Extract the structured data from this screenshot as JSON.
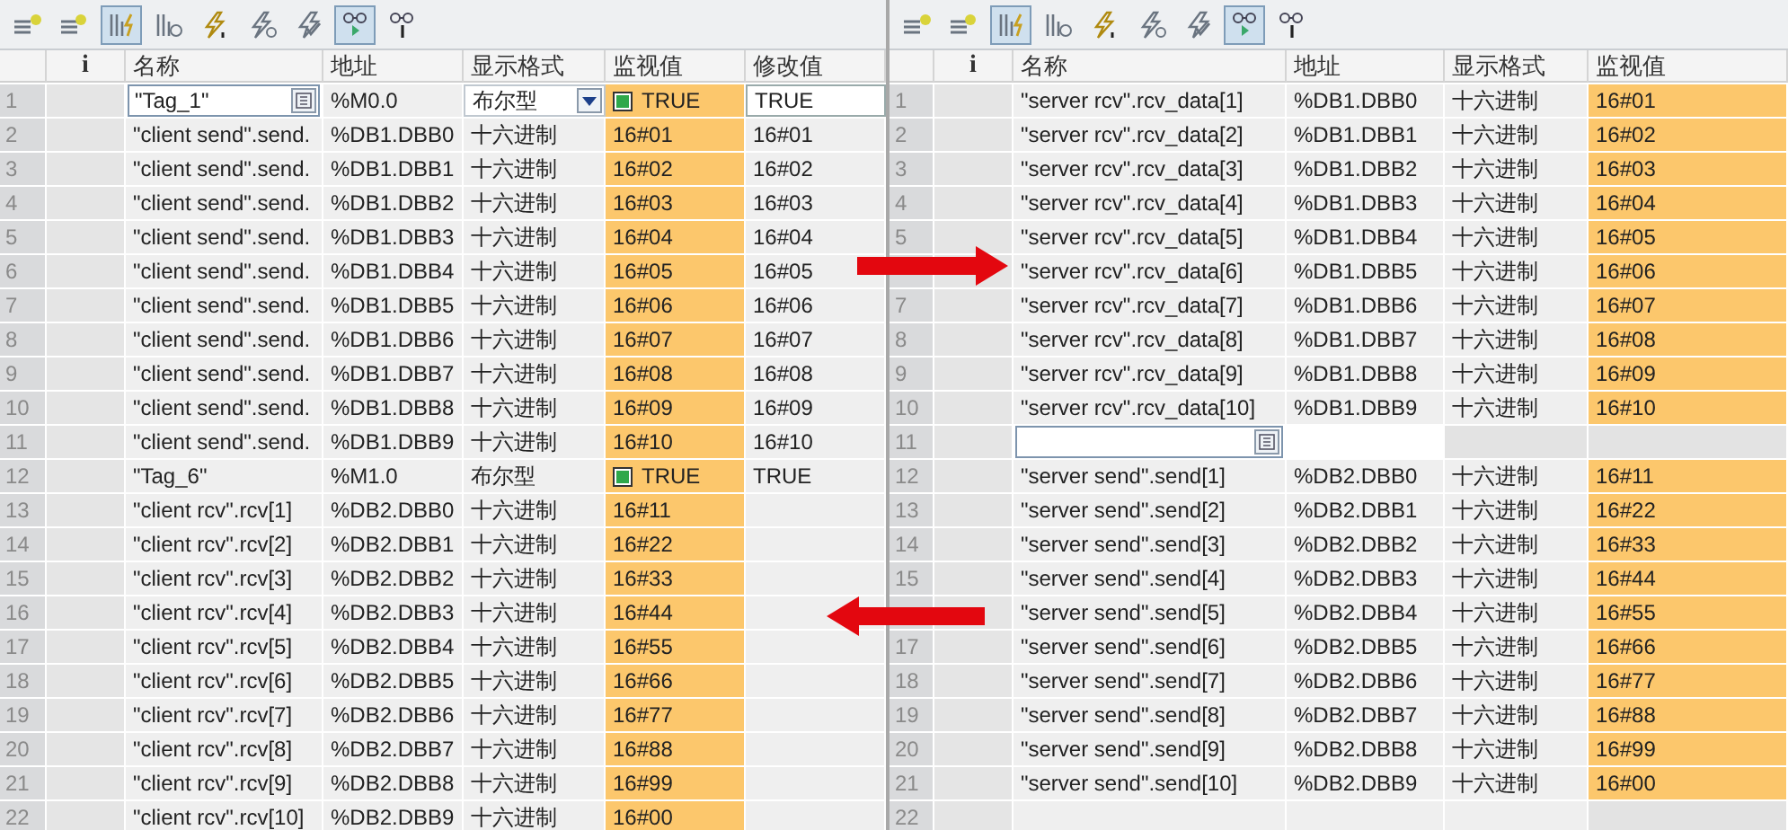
{
  "panels": [
    {
      "toolbar": [
        {
          "kind": "insert-row",
          "pressed": false
        },
        {
          "kind": "add-row",
          "pressed": false
        },
        {
          "kind": "modify-now",
          "pressed": true
        },
        {
          "kind": "modify-time",
          "pressed": false
        },
        {
          "kind": "force",
          "pressed": false
        },
        {
          "kind": "force-time",
          "pressed": false
        },
        {
          "kind": "check",
          "pressed": false
        },
        {
          "kind": "monitor-all",
          "pressed": true
        },
        {
          "kind": "monitor-once",
          "pressed": false
        }
      ],
      "columns": [
        "i",
        "名称",
        "地址",
        "显示格式",
        "监视值",
        "修改值"
      ],
      "rows": [
        {
          "num": "1",
          "name": "\"Tag_1\"",
          "address": "%M0.0",
          "format": "布尔型",
          "monitor": "TRUE",
          "led": true,
          "modify": "TRUE",
          "editing": true
        },
        {
          "num": "2",
          "name": "\"client send\".send.",
          "address": "%DB1.DBB0",
          "format": "十六进制",
          "monitor": "16#01",
          "modify": "16#01",
          "editing": false
        },
        {
          "num": "3",
          "name": "\"client send\".send.",
          "address": "%DB1.DBB1",
          "format": "十六进制",
          "monitor": "16#02",
          "modify": "16#02",
          "editing": false
        },
        {
          "num": "4",
          "name": "\"client send\".send.",
          "address": "%DB1.DBB2",
          "format": "十六进制",
          "monitor": "16#03",
          "modify": "16#03",
          "editing": false
        },
        {
          "num": "5",
          "name": "\"client send\".send.",
          "address": "%DB1.DBB3",
          "format": "十六进制",
          "monitor": "16#04",
          "modify": "16#04",
          "editing": false
        },
        {
          "num": "6",
          "name": "\"client send\".send.",
          "address": "%DB1.DBB4",
          "format": "十六进制",
          "monitor": "16#05",
          "modify": "16#05",
          "editing": false
        },
        {
          "num": "7",
          "name": "\"client send\".send.",
          "address": "%DB1.DBB5",
          "format": "十六进制",
          "monitor": "16#06",
          "modify": "16#06",
          "editing": false
        },
        {
          "num": "8",
          "name": "\"client send\".send.",
          "address": "%DB1.DBB6",
          "format": "十六进制",
          "monitor": "16#07",
          "modify": "16#07",
          "editing": false
        },
        {
          "num": "9",
          "name": "\"client send\".send.",
          "address": "%DB1.DBB7",
          "format": "十六进制",
          "monitor": "16#08",
          "modify": "16#08",
          "editing": false
        },
        {
          "num": "10",
          "name": "\"client send\".send.",
          "address": "%DB1.DBB8",
          "format": "十六进制",
          "monitor": "16#09",
          "modify": "16#09",
          "editing": false
        },
        {
          "num": "11",
          "name": "\"client send\".send.",
          "address": "%DB1.DBB9",
          "format": "十六进制",
          "monitor": "16#10",
          "modify": "16#10",
          "editing": false
        },
        {
          "num": "12",
          "name": "\"Tag_6\"",
          "address": "%M1.0",
          "format": "布尔型",
          "monitor": "TRUE",
          "led": true,
          "modify": "TRUE",
          "editing": false
        },
        {
          "num": "13",
          "name": "\"client rcv\".rcv[1]",
          "address": "%DB2.DBB0",
          "format": "十六进制",
          "monitor": "16#11",
          "editing": false
        },
        {
          "num": "14",
          "name": "\"client rcv\".rcv[2]",
          "address": "%DB2.DBB1",
          "format": "十六进制",
          "monitor": "16#22",
          "editing": false
        },
        {
          "num": "15",
          "name": "\"client rcv\".rcv[3]",
          "address": "%DB2.DBB2",
          "format": "十六进制",
          "monitor": "16#33",
          "editing": false
        },
        {
          "num": "16",
          "name": "\"client rcv\".rcv[4]",
          "address": "%DB2.DBB3",
          "format": "十六进制",
          "monitor": "16#44",
          "editing": false
        },
        {
          "num": "17",
          "name": "\"client rcv\".rcv[5]",
          "address": "%DB2.DBB4",
          "format": "十六进制",
          "monitor": "16#55",
          "editing": false
        },
        {
          "num": "18",
          "name": "\"client rcv\".rcv[6]",
          "address": "%DB2.DBB5",
          "format": "十六进制",
          "monitor": "16#66",
          "editing": false
        },
        {
          "num": "19",
          "name": "\"client rcv\".rcv[7]",
          "address": "%DB2.DBB6",
          "format": "十六进制",
          "monitor": "16#77",
          "editing": false
        },
        {
          "num": "20",
          "name": "\"client rcv\".rcv[8]",
          "address": "%DB2.DBB7",
          "format": "十六进制",
          "monitor": "16#88",
          "editing": false
        },
        {
          "num": "21",
          "name": "\"client rcv\".rcv[9]",
          "address": "%DB2.DBB8",
          "format": "十六进制",
          "monitor": "16#99",
          "editing": false
        },
        {
          "num": "22",
          "name": "\"client rcv\".rcv[10]",
          "address": "%DB2.DBB9",
          "format": "十六进制",
          "monitor": "16#00",
          "editing": false
        }
      ]
    },
    {
      "toolbar": [
        {
          "kind": "insert-row",
          "pressed": false
        },
        {
          "kind": "add-row",
          "pressed": false
        },
        {
          "kind": "modify-now",
          "pressed": true
        },
        {
          "kind": "modify-time",
          "pressed": false
        },
        {
          "kind": "force",
          "pressed": false
        },
        {
          "kind": "force-time",
          "pressed": false
        },
        {
          "kind": "check",
          "pressed": false
        },
        {
          "kind": "monitor-all",
          "pressed": true
        },
        {
          "kind": "monitor-once",
          "pressed": false
        }
      ],
      "columns": [
        "i",
        "名称",
        "地址",
        "显示格式",
        "监视值"
      ],
      "rows": [
        {
          "num": "1",
          "name": "\"server rcv\".rcv_data[1]",
          "address": "%DB1.DBB0",
          "format": "十六进制",
          "monitor": "16#01",
          "editing": false
        },
        {
          "num": "2",
          "name": "\"server rcv\".rcv_data[2]",
          "address": "%DB1.DBB1",
          "format": "十六进制",
          "monitor": "16#02",
          "editing": false
        },
        {
          "num": "3",
          "name": "\"server rcv\".rcv_data[3]",
          "address": "%DB1.DBB2",
          "format": "十六进制",
          "monitor": "16#03",
          "editing": false
        },
        {
          "num": "4",
          "name": "\"server rcv\".rcv_data[4]",
          "address": "%DB1.DBB3",
          "format": "十六进制",
          "monitor": "16#04",
          "editing": false
        },
        {
          "num": "5",
          "name": "\"server rcv\".rcv_data[5]",
          "address": "%DB1.DBB4",
          "format": "十六进制",
          "monitor": "16#05",
          "editing": false
        },
        {
          "name": "\"server rcv\".rcv_data[6]",
          "address": "%DB1.DBB5",
          "format": "十六进制",
          "monitor": "16#06",
          "editing": false
        },
        {
          "num": "7",
          "name": "\"server rcv\".rcv_data[7]",
          "address": "%DB1.DBB6",
          "format": "十六进制",
          "monitor": "16#07",
          "editing": false
        },
        {
          "num": "8",
          "name": "\"server rcv\".rcv_data[8]",
          "address": "%DB1.DBB7",
          "format": "十六进制",
          "monitor": "16#08",
          "editing": false
        },
        {
          "num": "9",
          "name": "\"server rcv\".rcv_data[9]",
          "address": "%DB1.DBB8",
          "format": "十六进制",
          "monitor": "16#09",
          "editing": false
        },
        {
          "num": "10",
          "name": "\"server rcv\".rcv_data[10]",
          "address": "%DB1.DBB9",
          "format": "十六进制",
          "monitor": "16#10",
          "editing": false
        },
        {
          "num": "11",
          "editing": true
        },
        {
          "num": "12",
          "name": "\"server send\".send[1]",
          "address": "%DB2.DBB0",
          "format": "十六进制",
          "monitor": "16#11",
          "editing": false
        },
        {
          "num": "13",
          "name": "\"server send\".send[2]",
          "address": "%DB2.DBB1",
          "format": "十六进制",
          "monitor": "16#22",
          "editing": false
        },
        {
          "num": "14",
          "name": "\"server send\".send[3]",
          "address": "%DB2.DBB2",
          "format": "十六进制",
          "monitor": "16#33",
          "editing": false
        },
        {
          "num": "15",
          "name": "\"server send\".send[4]",
          "address": "%DB2.DBB3",
          "format": "十六进制",
          "monitor": "16#44",
          "editing": false
        },
        {
          "name": "\"server send\".send[5]",
          "address": "%DB2.DBB4",
          "format": "十六进制",
          "monitor": "16#55",
          "editing": false
        },
        {
          "num": "17",
          "name": "\"server send\".send[6]",
          "address": "%DB2.DBB5",
          "format": "十六进制",
          "monitor": "16#66",
          "editing": false
        },
        {
          "num": "18",
          "name": "\"server send\".send[7]",
          "address": "%DB2.DBB6",
          "format": "十六进制",
          "monitor": "16#77",
          "editing": false
        },
        {
          "num": "19",
          "name": "\"server send\".send[8]",
          "address": "%DB2.DBB7",
          "format": "十六进制",
          "monitor": "16#88",
          "editing": false
        },
        {
          "num": "20",
          "name": "\"server send\".send[9]",
          "address": "%DB2.DBB8",
          "format": "十六进制",
          "monitor": "16#99",
          "editing": false
        },
        {
          "num": "21",
          "name": "\"server send\".send[10]",
          "address": "%DB2.DBB9",
          "format": "十六进制",
          "monitor": "16#00",
          "editing": false
        },
        {
          "num": "22",
          "editing": false
        }
      ]
    }
  ]
}
